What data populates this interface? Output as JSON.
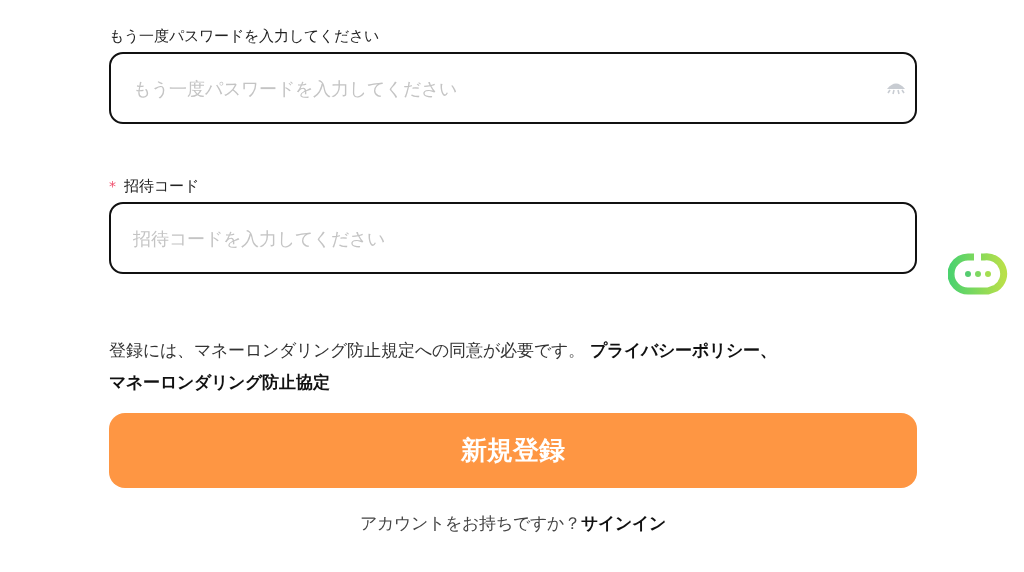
{
  "fields": [
    {
      "label": "もう一度パスワードを入力してください",
      "placeholder": "もう一度パスワードを入力してください",
      "required": false,
      "kind": "password"
    },
    {
      "label": "招待コード",
      "placeholder": "招待コードを入力してください",
      "required": true,
      "kind": "text"
    }
  ],
  "required_mark": "*",
  "consent": {
    "text": "登録には、マネーロンダリング防止規定への同意が必要です。",
    "links": [
      "プライバシーポリシー、",
      "マネーロンダリング防止協定"
    ]
  },
  "submit_button": "新規登録",
  "footer": {
    "text": "アカウントをお持ちですか？",
    "link": "サインイン"
  }
}
